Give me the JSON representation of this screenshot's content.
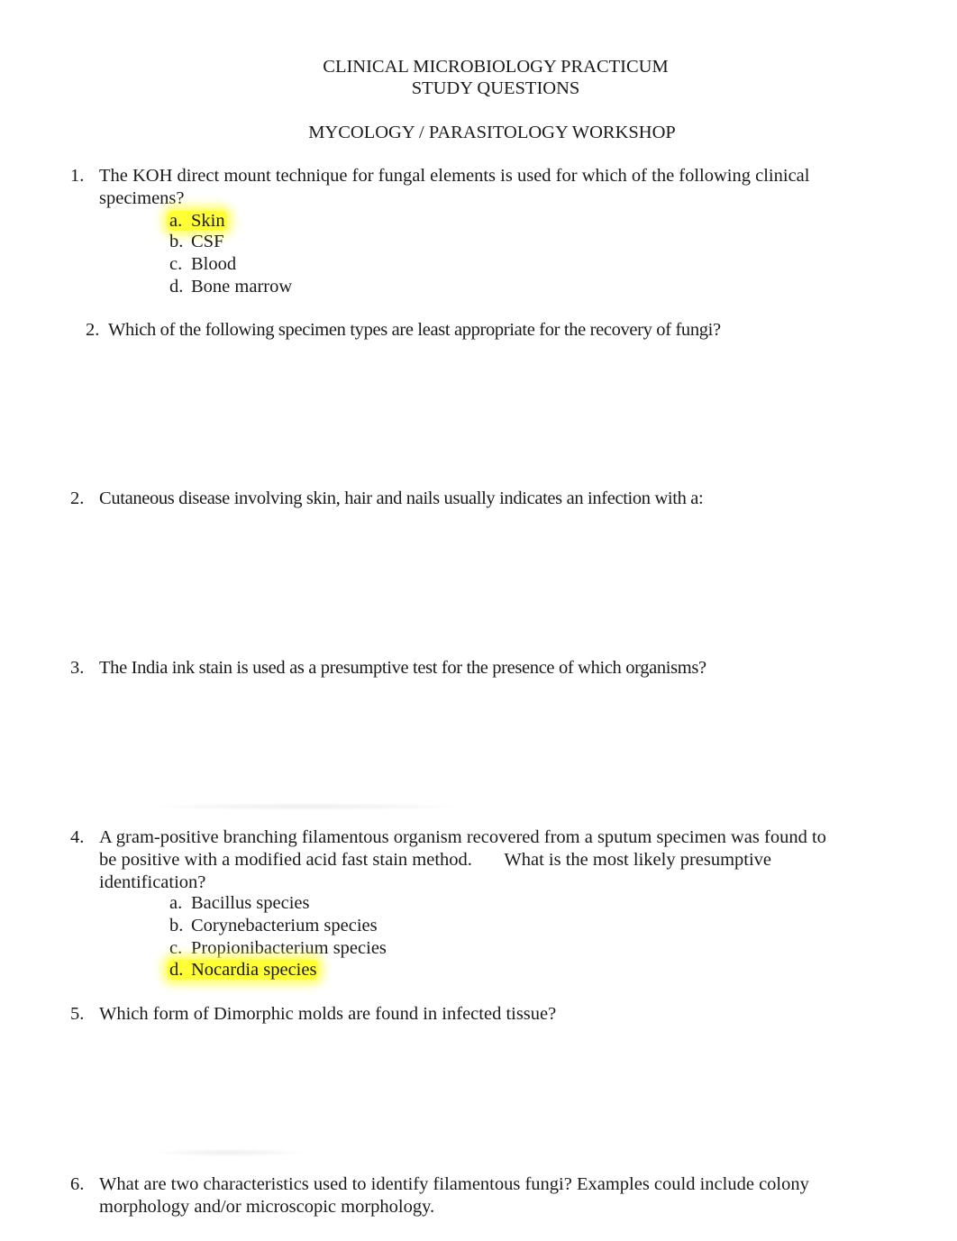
{
  "header": {
    "line1": "CLINICAL MICROBIOLOGY PRACTICUM",
    "line2": "STUDY QUESTIONS",
    "subtitle": "MYCOLOGY / PARASITOLOGY WORKSHOP"
  },
  "questions": [
    {
      "number": "1.",
      "lines": [
        "The KOH direct mount technique for fungal elements is used for which of the following clinical",
        "specimens?"
      ],
      "options": [
        {
          "letter": "a.",
          "text": "Skin",
          "highlighted": true
        },
        {
          "letter": "b.",
          "text": "CSF",
          "highlighted": false
        },
        {
          "letter": "c.",
          "text": "Blood",
          "highlighted": false
        },
        {
          "letter": "d.",
          "text": "Bone marrow",
          "highlighted": false
        }
      ]
    },
    {
      "number": "2.",
      "lines": [
        "Which of the following specimen types are least appropriate for the recovery of fungi?"
      ]
    },
    {
      "number": "2.",
      "lines": [
        "Cutaneous disease involving skin, hair and nails usually indicates an infection with a:"
      ]
    },
    {
      "number": "3.",
      "lines": [
        "The India ink stain is used as a presumptive test for the presence of which organisms?"
      ]
    },
    {
      "number": "4.",
      "lines": [
        "A gram-positive branching filamentous organism recovered from a sputum specimen was found to",
        "be positive with a modified acid fast stain method.       What is the most likely presumptive",
        "identification?"
      ],
      "options": [
        {
          "letter": "a.",
          "text": "Bacillus species",
          "highlighted": false
        },
        {
          "letter": "b.",
          "text": "Corynebacterium species",
          "highlighted": false
        },
        {
          "letter": "c.",
          "text": "Propionibacterium species",
          "highlighted": false
        },
        {
          "letter": "d.",
          "text": "Nocardia species",
          "highlighted": true
        }
      ]
    },
    {
      "number": "5.",
      "lines": [
        "Which form of Dimorphic molds are found in infected tissue?"
      ]
    },
    {
      "number": "6.",
      "lines": [
        "What are two characteristics used to identify filamentous fungi? Examples could include colony",
        "morphology and/or microscopic morphology."
      ]
    }
  ],
  "colors": {
    "highlight": "#ffff33",
    "text": "#1a1a1a"
  }
}
